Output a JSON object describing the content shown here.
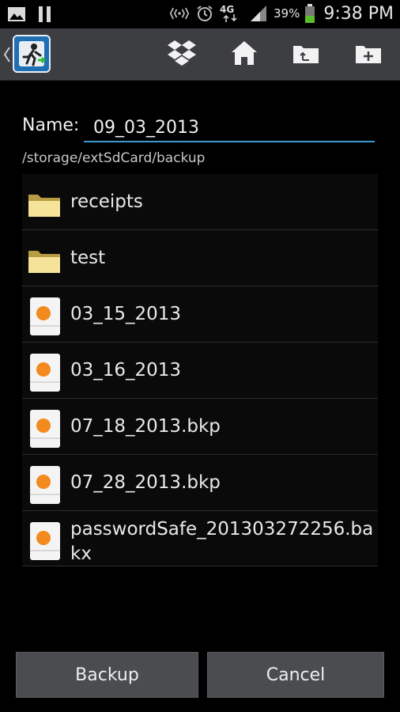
{
  "status_bar": {
    "battery": "39%",
    "clock": "9:38 PM",
    "network": "4G",
    "icons": [
      "gallery-icon",
      "pause-icon",
      "cast-icon",
      "alarm-icon",
      "4g-icon",
      "signal-icon",
      "battery-icon"
    ]
  },
  "action_bar": {
    "icons": [
      "up-caret-icon",
      "app-logo-icon",
      "dropbox-icon",
      "home-icon",
      "parent-folder-icon",
      "new-folder-icon"
    ]
  },
  "dialog": {
    "name_label": "Name:",
    "name_value": "09_03_2013",
    "path": "/storage/extSdCard/backup"
  },
  "files": [
    {
      "name": "receipts",
      "type": "folder"
    },
    {
      "name": "test",
      "type": "folder"
    },
    {
      "name": "03_15_2013",
      "type": "file"
    },
    {
      "name": "03_16_2013",
      "type": "file"
    },
    {
      "name": "07_18_2013.bkp",
      "type": "file"
    },
    {
      "name": "07_28_2013.bkp",
      "type": "file"
    },
    {
      "name": "passwordSafe_201303272256.bakx",
      "type": "file"
    }
  ],
  "buttons": {
    "backup": "Backup",
    "cancel": "Cancel"
  },
  "colors": {
    "accent": "#3d9ad1",
    "folder": "#f5e39a",
    "file_dot": "#f28a1e"
  }
}
